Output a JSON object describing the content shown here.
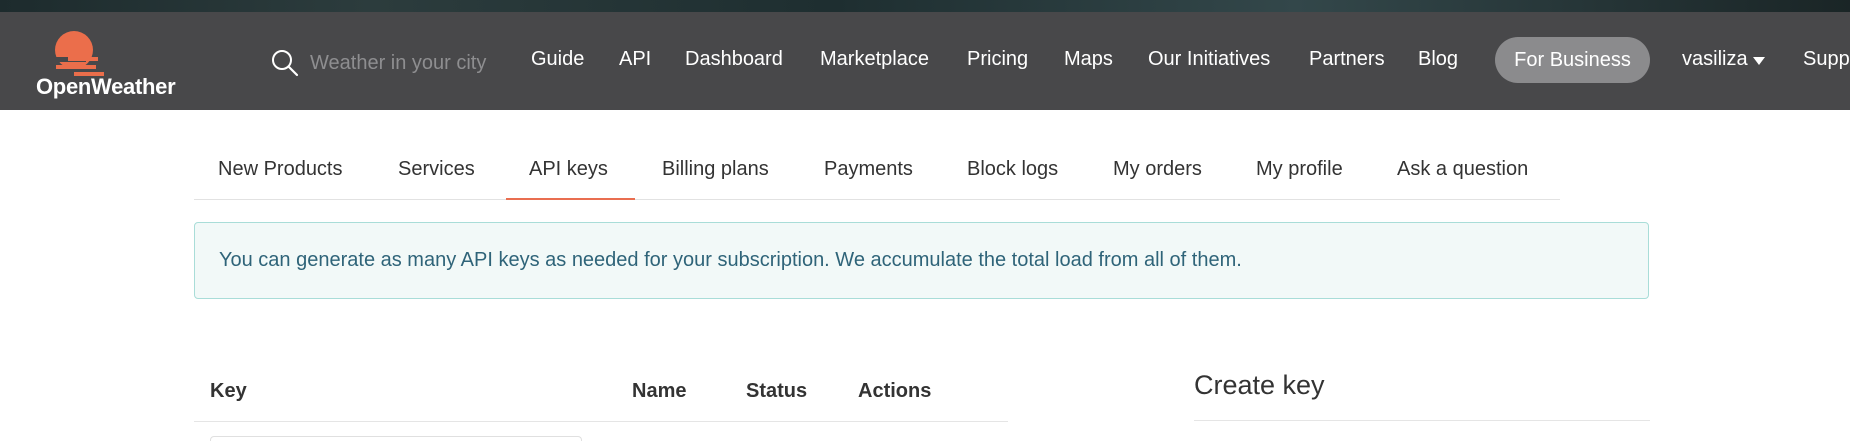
{
  "brand": {
    "name": "OpenWeather",
    "accent": "#eb6e4b",
    "header_bg": "#48484a"
  },
  "search": {
    "placeholder": "Weather in your city"
  },
  "nav": {
    "items": [
      {
        "label": "Guide"
      },
      {
        "label": "API"
      },
      {
        "label": "Dashboard"
      },
      {
        "label": "Marketplace"
      },
      {
        "label": "Pricing"
      },
      {
        "label": "Maps"
      },
      {
        "label": "Our Initiatives"
      },
      {
        "label": "Partners"
      },
      {
        "label": "Blog"
      }
    ],
    "business_label": "For Business",
    "user_label": "vasiliza",
    "support_label": "Supp"
  },
  "subnav": {
    "items": [
      {
        "label": "New Products"
      },
      {
        "label": "Services"
      },
      {
        "label": "API keys"
      },
      {
        "label": "Billing plans"
      },
      {
        "label": "Payments"
      },
      {
        "label": "Block logs"
      },
      {
        "label": "My orders"
      },
      {
        "label": "My profile"
      },
      {
        "label": "Ask a question"
      }
    ],
    "active": "API keys"
  },
  "alert": {
    "text": "You can generate as many API keys as needed for your subscription. We accumulate the total load from all of them."
  },
  "keys_table": {
    "columns": [
      "Key",
      "Name",
      "Status",
      "Actions"
    ]
  },
  "create_key": {
    "title": "Create key"
  }
}
